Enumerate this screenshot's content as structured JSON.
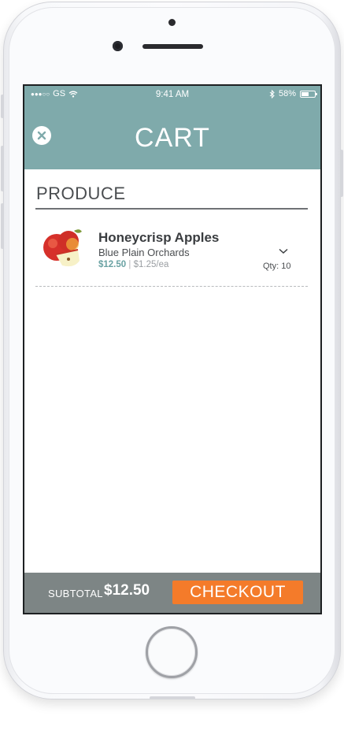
{
  "status_bar": {
    "carrier": "GS",
    "time": "9:41 AM",
    "battery": "58%",
    "battery_level": 0.58
  },
  "header": {
    "title": "CART",
    "close_icon": "close-icon"
  },
  "section": {
    "title": "PRODUCE"
  },
  "items": [
    {
      "name": "Honeycrisp Apples",
      "vendor": "Blue Plain Orchards",
      "price": "$12.50",
      "unit_price": "$1.25/ea",
      "qty": "Qty: 10",
      "icon": "apple-image"
    }
  ],
  "footer": {
    "subtotal_label": "SUBTOTAL",
    "subtotal_value": "$12.50",
    "checkout_label": "CHECKOUT"
  },
  "colors": {
    "header": "#7faaab",
    "accent_price": "#6aa2a3",
    "checkout": "#f47b2a",
    "footer": "#7d8585"
  }
}
